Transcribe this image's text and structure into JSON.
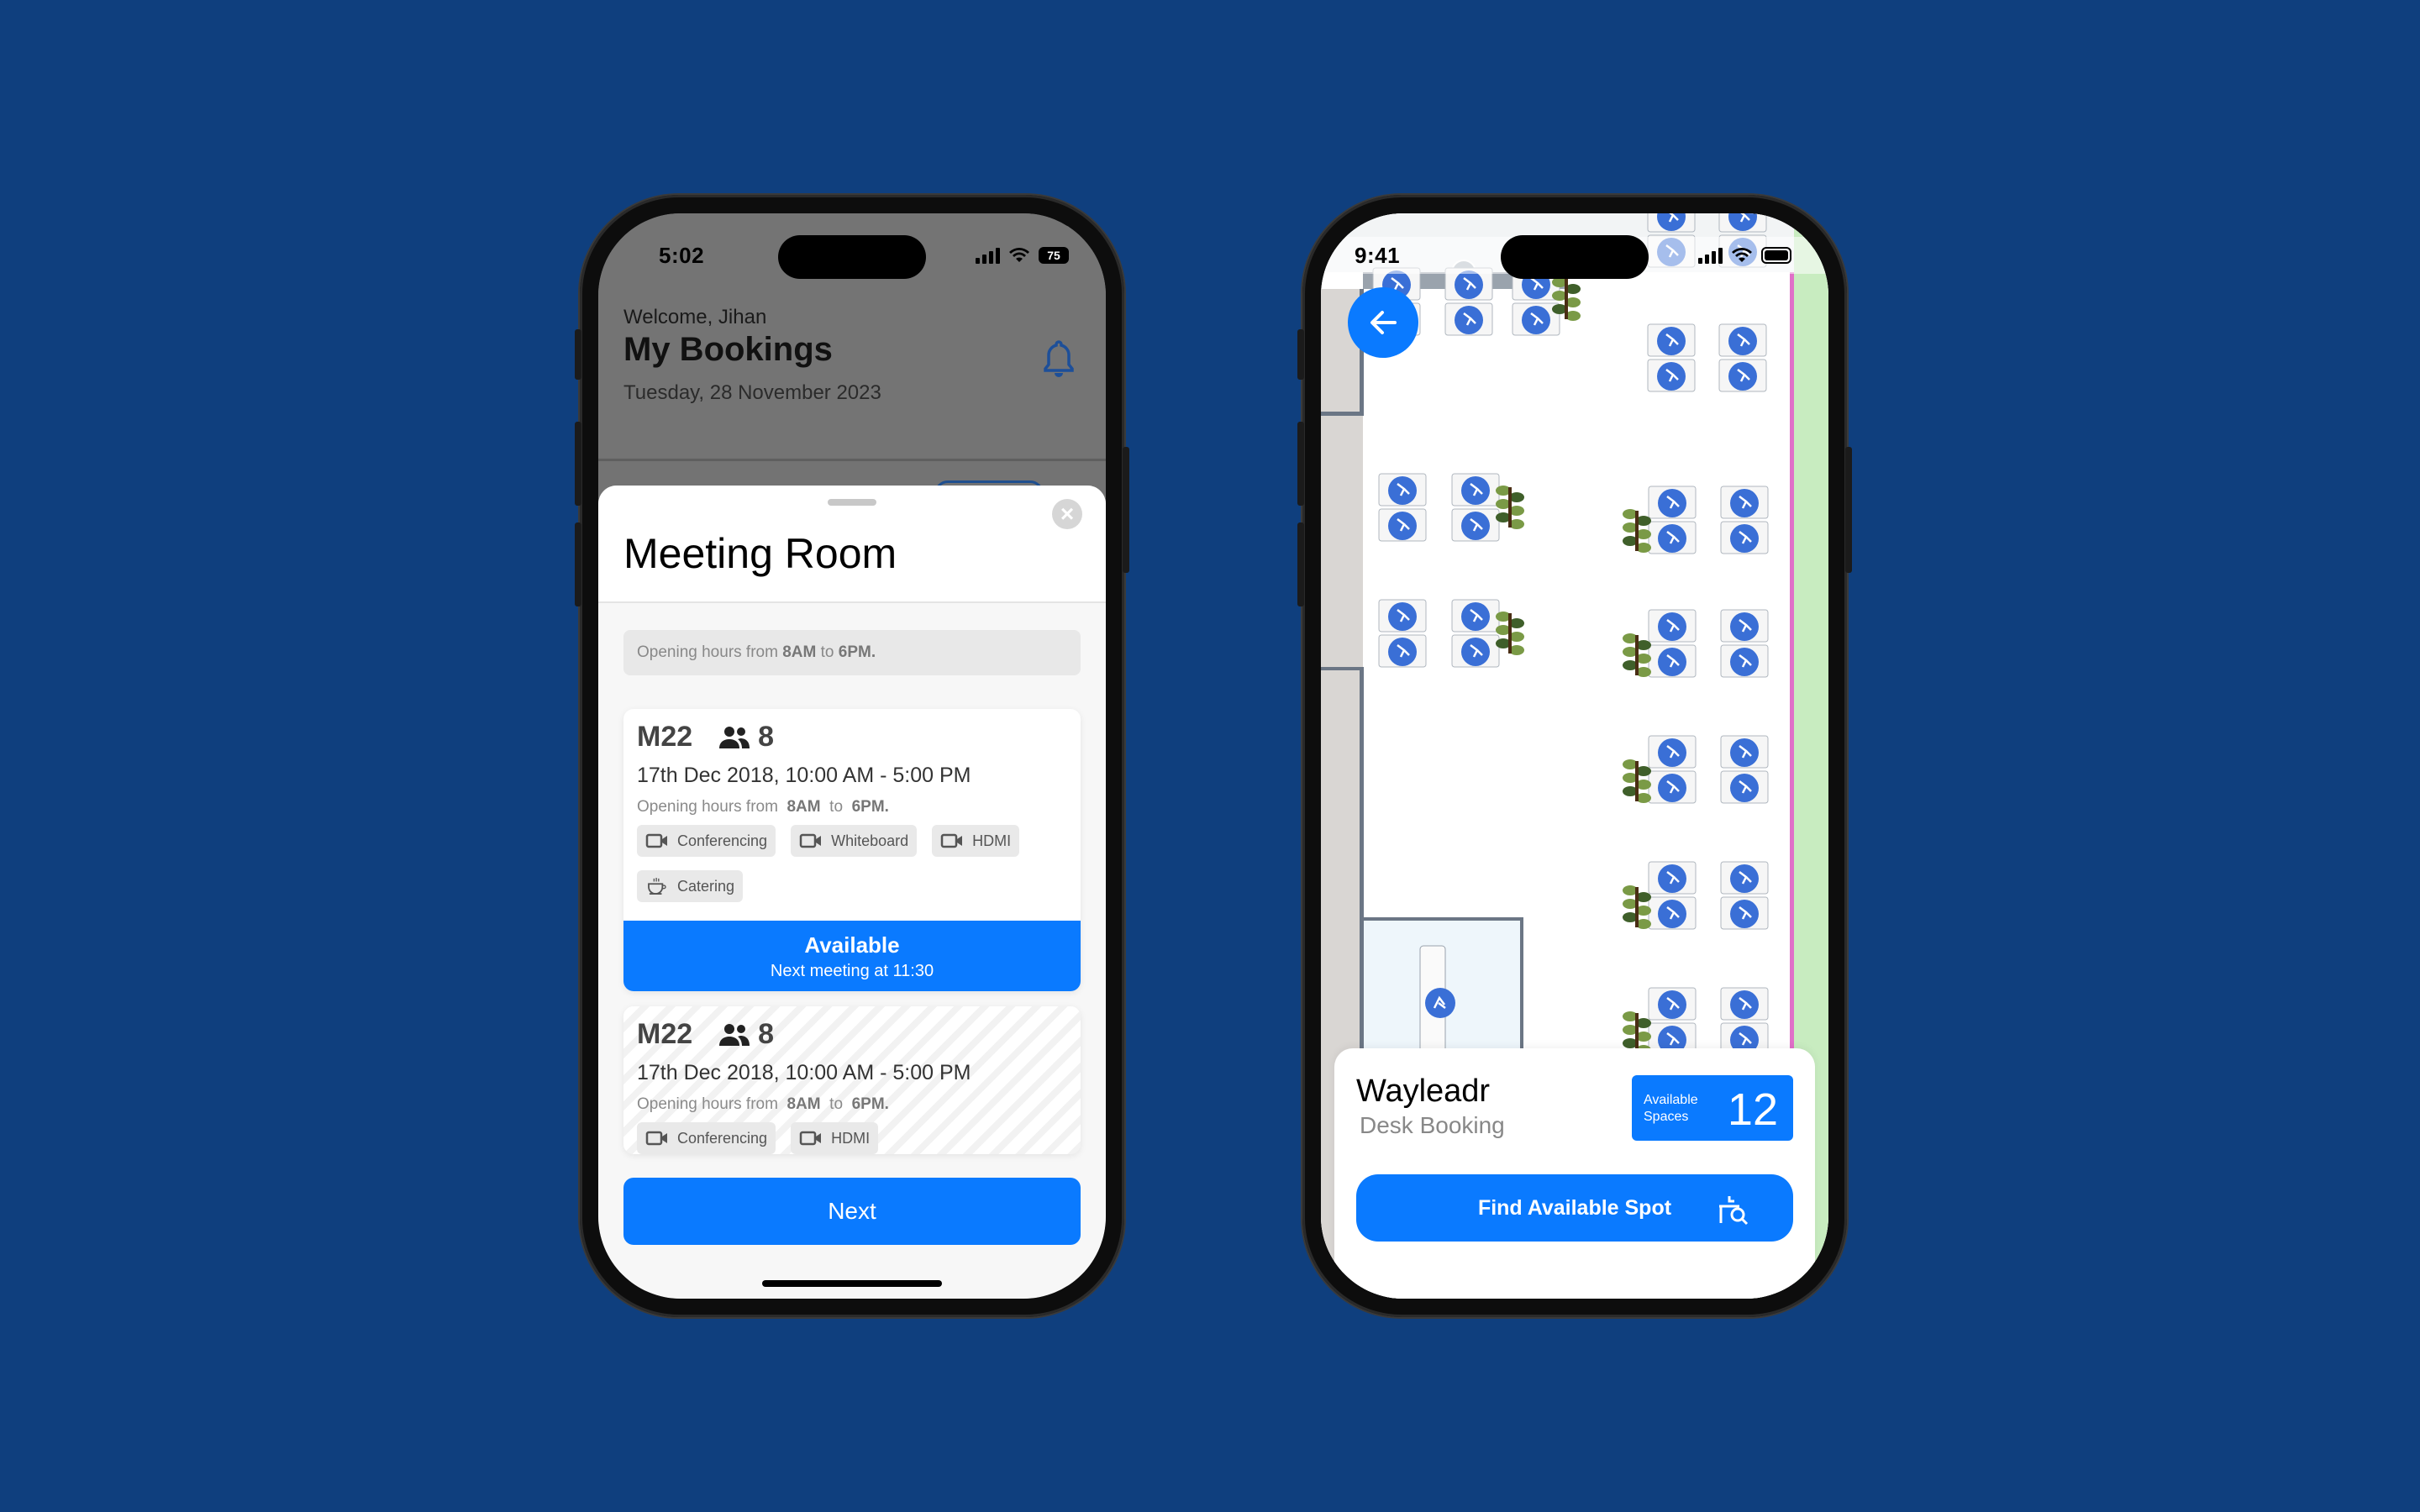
{
  "left_phone": {
    "status": {
      "time": "5:02",
      "battery": "75"
    },
    "background": {
      "welcome": "Welcome, Jihan",
      "title": "My Bookings",
      "date": "Tuesday, 28 November 2023"
    },
    "sheet": {
      "title": "Meeting Room",
      "opening_hours": {
        "prefix": "Opening hours from ",
        "open": "8AM",
        "mid": " to ",
        "close": "6PM."
      },
      "rooms": [
        {
          "name": "M22",
          "capacity": "8",
          "when": "17th Dec 2018, 10:00 AM - 5:00 PM",
          "hours": {
            "prefix": "Opening hours from ",
            "open": "8AM",
            "mid": " to ",
            "close": "6PM."
          },
          "amenities": [
            {
              "icon": "video-camera-icon",
              "label": "Conferencing"
            },
            {
              "icon": "video-camera-icon",
              "label": "Whiteboard"
            },
            {
              "icon": "video-camera-icon",
              "label": "HDMI"
            },
            {
              "icon": "coffee-cup-icon",
              "label": "Catering"
            }
          ],
          "status": "Available",
          "status_sub": "Next meeting at 11:30"
        },
        {
          "name": "M22",
          "capacity": "8",
          "when": "17th Dec 2018, 10:00 AM - 5:00 PM",
          "hours": {
            "prefix": "Opening hours from ",
            "open": "8AM",
            "mid": " to ",
            "close": "6PM."
          },
          "amenities": [
            {
              "icon": "video-camera-icon",
              "label": "Conferencing"
            },
            {
              "icon": "video-camera-icon",
              "label": "HDMI"
            }
          ]
        }
      ],
      "next_label": "Next"
    }
  },
  "right_phone": {
    "status": {
      "time": "9:41"
    },
    "card": {
      "brand": "Wayleadr",
      "subtitle": "Desk Booking",
      "spaces_label_1": "Available",
      "spaces_label_2": "Spaces",
      "spaces_count": "12",
      "find_label": "Find Available Spot"
    }
  },
  "colors": {
    "accent": "#0a7aff",
    "background": "#0f3f7e",
    "desk_marker": "#3a6fd6",
    "plant": "#6b8a3a",
    "room_fill": "#eef6fb",
    "wall": "#6b7685",
    "pink_line": "#e070c8",
    "green_zone": "#c8ecc0"
  }
}
